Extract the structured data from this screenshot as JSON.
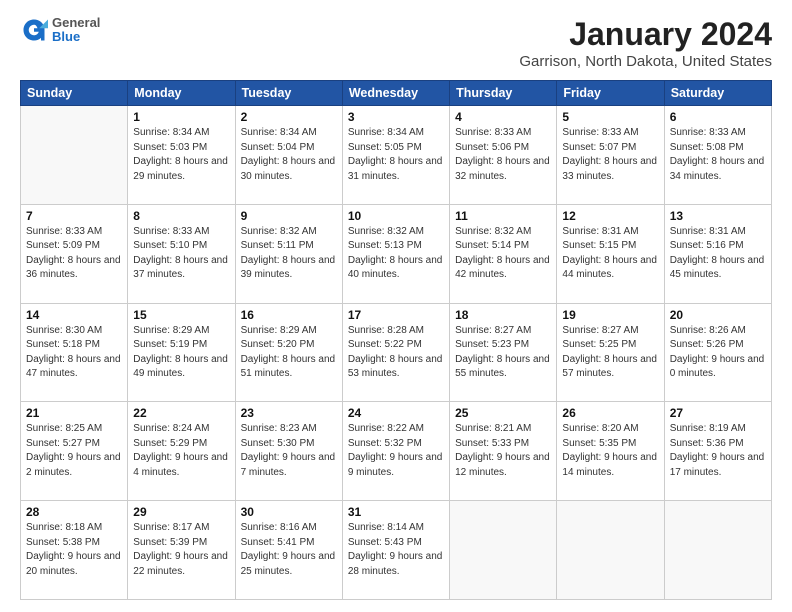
{
  "header": {
    "logo": {
      "general": "General",
      "blue": "Blue"
    },
    "title": "January 2024",
    "location": "Garrison, North Dakota, United States"
  },
  "weekdays": [
    "Sunday",
    "Monday",
    "Tuesday",
    "Wednesday",
    "Thursday",
    "Friday",
    "Saturday"
  ],
  "weeks": [
    [
      {
        "day": "",
        "sunrise": "",
        "sunset": "",
        "daylight": ""
      },
      {
        "day": "1",
        "sunrise": "Sunrise: 8:34 AM",
        "sunset": "Sunset: 5:03 PM",
        "daylight": "Daylight: 8 hours and 29 minutes."
      },
      {
        "day": "2",
        "sunrise": "Sunrise: 8:34 AM",
        "sunset": "Sunset: 5:04 PM",
        "daylight": "Daylight: 8 hours and 30 minutes."
      },
      {
        "day": "3",
        "sunrise": "Sunrise: 8:34 AM",
        "sunset": "Sunset: 5:05 PM",
        "daylight": "Daylight: 8 hours and 31 minutes."
      },
      {
        "day": "4",
        "sunrise": "Sunrise: 8:33 AM",
        "sunset": "Sunset: 5:06 PM",
        "daylight": "Daylight: 8 hours and 32 minutes."
      },
      {
        "day": "5",
        "sunrise": "Sunrise: 8:33 AM",
        "sunset": "Sunset: 5:07 PM",
        "daylight": "Daylight: 8 hours and 33 minutes."
      },
      {
        "day": "6",
        "sunrise": "Sunrise: 8:33 AM",
        "sunset": "Sunset: 5:08 PM",
        "daylight": "Daylight: 8 hours and 34 minutes."
      }
    ],
    [
      {
        "day": "7",
        "sunrise": "Sunrise: 8:33 AM",
        "sunset": "Sunset: 5:09 PM",
        "daylight": "Daylight: 8 hours and 36 minutes."
      },
      {
        "day": "8",
        "sunrise": "Sunrise: 8:33 AM",
        "sunset": "Sunset: 5:10 PM",
        "daylight": "Daylight: 8 hours and 37 minutes."
      },
      {
        "day": "9",
        "sunrise": "Sunrise: 8:32 AM",
        "sunset": "Sunset: 5:11 PM",
        "daylight": "Daylight: 8 hours and 39 minutes."
      },
      {
        "day": "10",
        "sunrise": "Sunrise: 8:32 AM",
        "sunset": "Sunset: 5:13 PM",
        "daylight": "Daylight: 8 hours and 40 minutes."
      },
      {
        "day": "11",
        "sunrise": "Sunrise: 8:32 AM",
        "sunset": "Sunset: 5:14 PM",
        "daylight": "Daylight: 8 hours and 42 minutes."
      },
      {
        "day": "12",
        "sunrise": "Sunrise: 8:31 AM",
        "sunset": "Sunset: 5:15 PM",
        "daylight": "Daylight: 8 hours and 44 minutes."
      },
      {
        "day": "13",
        "sunrise": "Sunrise: 8:31 AM",
        "sunset": "Sunset: 5:16 PM",
        "daylight": "Daylight: 8 hours and 45 minutes."
      }
    ],
    [
      {
        "day": "14",
        "sunrise": "Sunrise: 8:30 AM",
        "sunset": "Sunset: 5:18 PM",
        "daylight": "Daylight: 8 hours and 47 minutes."
      },
      {
        "day": "15",
        "sunrise": "Sunrise: 8:29 AM",
        "sunset": "Sunset: 5:19 PM",
        "daylight": "Daylight: 8 hours and 49 minutes."
      },
      {
        "day": "16",
        "sunrise": "Sunrise: 8:29 AM",
        "sunset": "Sunset: 5:20 PM",
        "daylight": "Daylight: 8 hours and 51 minutes."
      },
      {
        "day": "17",
        "sunrise": "Sunrise: 8:28 AM",
        "sunset": "Sunset: 5:22 PM",
        "daylight": "Daylight: 8 hours and 53 minutes."
      },
      {
        "day": "18",
        "sunrise": "Sunrise: 8:27 AM",
        "sunset": "Sunset: 5:23 PM",
        "daylight": "Daylight: 8 hours and 55 minutes."
      },
      {
        "day": "19",
        "sunrise": "Sunrise: 8:27 AM",
        "sunset": "Sunset: 5:25 PM",
        "daylight": "Daylight: 8 hours and 57 minutes."
      },
      {
        "day": "20",
        "sunrise": "Sunrise: 8:26 AM",
        "sunset": "Sunset: 5:26 PM",
        "daylight": "Daylight: 9 hours and 0 minutes."
      }
    ],
    [
      {
        "day": "21",
        "sunrise": "Sunrise: 8:25 AM",
        "sunset": "Sunset: 5:27 PM",
        "daylight": "Daylight: 9 hours and 2 minutes."
      },
      {
        "day": "22",
        "sunrise": "Sunrise: 8:24 AM",
        "sunset": "Sunset: 5:29 PM",
        "daylight": "Daylight: 9 hours and 4 minutes."
      },
      {
        "day": "23",
        "sunrise": "Sunrise: 8:23 AM",
        "sunset": "Sunset: 5:30 PM",
        "daylight": "Daylight: 9 hours and 7 minutes."
      },
      {
        "day": "24",
        "sunrise": "Sunrise: 8:22 AM",
        "sunset": "Sunset: 5:32 PM",
        "daylight": "Daylight: 9 hours and 9 minutes."
      },
      {
        "day": "25",
        "sunrise": "Sunrise: 8:21 AM",
        "sunset": "Sunset: 5:33 PM",
        "daylight": "Daylight: 9 hours and 12 minutes."
      },
      {
        "day": "26",
        "sunrise": "Sunrise: 8:20 AM",
        "sunset": "Sunset: 5:35 PM",
        "daylight": "Daylight: 9 hours and 14 minutes."
      },
      {
        "day": "27",
        "sunrise": "Sunrise: 8:19 AM",
        "sunset": "Sunset: 5:36 PM",
        "daylight": "Daylight: 9 hours and 17 minutes."
      }
    ],
    [
      {
        "day": "28",
        "sunrise": "Sunrise: 8:18 AM",
        "sunset": "Sunset: 5:38 PM",
        "daylight": "Daylight: 9 hours and 20 minutes."
      },
      {
        "day": "29",
        "sunrise": "Sunrise: 8:17 AM",
        "sunset": "Sunset: 5:39 PM",
        "daylight": "Daylight: 9 hours and 22 minutes."
      },
      {
        "day": "30",
        "sunrise": "Sunrise: 8:16 AM",
        "sunset": "Sunset: 5:41 PM",
        "daylight": "Daylight: 9 hours and 25 minutes."
      },
      {
        "day": "31",
        "sunrise": "Sunrise: 8:14 AM",
        "sunset": "Sunset: 5:43 PM",
        "daylight": "Daylight: 9 hours and 28 minutes."
      },
      {
        "day": "",
        "sunrise": "",
        "sunset": "",
        "daylight": ""
      },
      {
        "day": "",
        "sunrise": "",
        "sunset": "",
        "daylight": ""
      },
      {
        "day": "",
        "sunrise": "",
        "sunset": "",
        "daylight": ""
      }
    ]
  ]
}
